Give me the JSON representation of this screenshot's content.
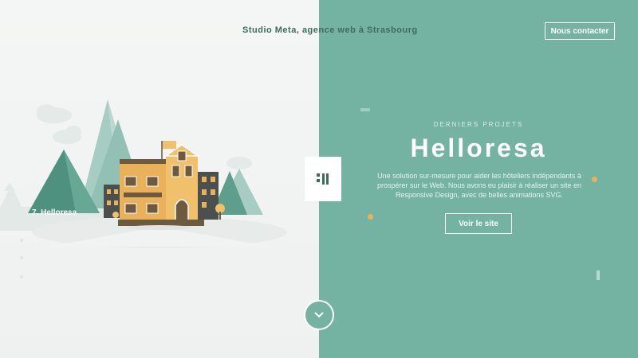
{
  "header": {
    "tagline": "Studio Meta, agence web à Strasbourg",
    "contact_label": "Nous contacter"
  },
  "project": {
    "kicker": "Derniers projets",
    "title": "Helloresa",
    "description": "Une solution sur-mesure pour aider les hôteliers indépendants à prospérer sur le Web. Nous avons eu plaisir à réaliser un site en Responsive Design, avec de belles animations SVG.",
    "cta_label": "Voir le site",
    "slide_label": "7. Helloresa"
  },
  "colors": {
    "accent": "#74b3a2",
    "left_bg": "#f4f6f5",
    "text_dark": "#3f6b5f",
    "building": "#e8b15a"
  },
  "icons": {
    "toggle": "grid-toggle-icon",
    "scroll": "chevron-down-icon"
  }
}
